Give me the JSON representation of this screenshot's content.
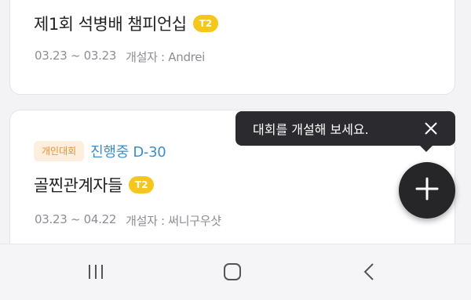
{
  "tournaments": [
    {
      "title": "제1회 석병배 챔피언십",
      "tier_badge": "T2",
      "date_range": "03.23 ~ 03.23",
      "organizer": "개설자 : Andrei"
    },
    {
      "type_tag": "개인대회",
      "status": "진행중 D-30",
      "title": "골찐관계자들",
      "tier_badge": "T2",
      "date_range": "03.23 ~ 04.22",
      "organizer": "개설자 : 써니구우샷"
    }
  ],
  "tooltip": {
    "message": "대회를 개설해 보세요."
  },
  "fab": {
    "icon": "plus-icon"
  },
  "navbar": {
    "recents_icon": "recent-apps-icon",
    "home_icon": "home-icon",
    "back_icon": "back-icon"
  },
  "colors": {
    "badge_yellow": "#f5c61c",
    "status_blue": "#3a8fc7",
    "tag_orange_text": "#e89133",
    "tag_orange_bg": "#fdeedd",
    "tooltip_bg": "#2b2b2f",
    "fab_bg": "#262629"
  }
}
